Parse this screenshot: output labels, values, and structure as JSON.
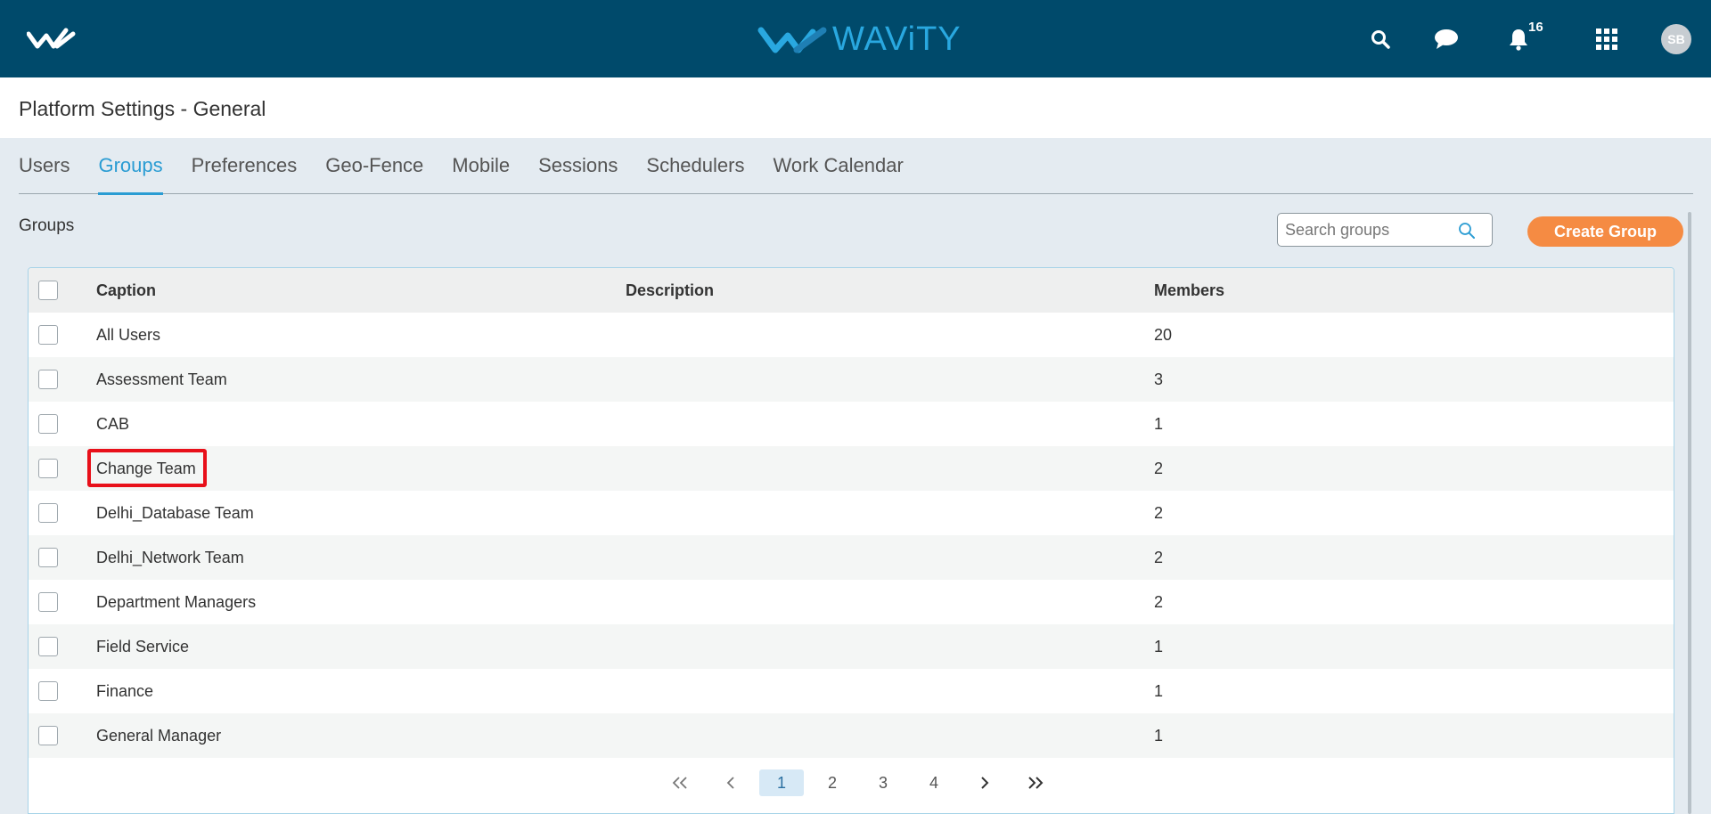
{
  "header": {
    "brand_name": "WAViTY",
    "notification_count": "16",
    "avatar_initials": "SB",
    "colors": {
      "topbar": "#004a6b",
      "brand": "#29a8e0",
      "accent": "#2a9cd3",
      "create_button": "#f58b43",
      "highlight": "#e8101a"
    },
    "icons": [
      "app-logo-icon",
      "search-icon",
      "chat-icon",
      "bell-icon",
      "apps-grid-icon"
    ]
  },
  "page": {
    "title": "Platform Settings - General"
  },
  "tabs": [
    {
      "label": "Users",
      "active": false
    },
    {
      "label": "Groups",
      "active": true
    },
    {
      "label": "Preferences",
      "active": false
    },
    {
      "label": "Geo-Fence",
      "active": false
    },
    {
      "label": "Mobile",
      "active": false
    },
    {
      "label": "Sessions",
      "active": false
    },
    {
      "label": "Schedulers",
      "active": false
    },
    {
      "label": "Work Calendar",
      "active": false
    }
  ],
  "groups": {
    "section_title": "Groups",
    "search_placeholder": "Search groups",
    "create_button_label": "Create Group",
    "columns": {
      "caption": "Caption",
      "description": "Description",
      "members": "Members"
    },
    "rows": [
      {
        "caption": "All Users",
        "description": "",
        "members": "20"
      },
      {
        "caption": "Assessment Team",
        "description": "",
        "members": "3"
      },
      {
        "caption": "CAB",
        "description": "",
        "members": "1"
      },
      {
        "caption": "Change Team",
        "description": "",
        "members": "2",
        "highlighted": true
      },
      {
        "caption": "Delhi_Database Team",
        "description": "",
        "members": "2"
      },
      {
        "caption": "Delhi_Network Team",
        "description": "",
        "members": "2"
      },
      {
        "caption": "Department Managers",
        "description": "",
        "members": "2"
      },
      {
        "caption": "Field Service",
        "description": "",
        "members": "1"
      },
      {
        "caption": "Finance",
        "description": "",
        "members": "1"
      },
      {
        "caption": "General Manager",
        "description": "",
        "members": "1"
      }
    ]
  },
  "pagination": {
    "pages": [
      "1",
      "2",
      "3",
      "4"
    ],
    "current": "1"
  }
}
